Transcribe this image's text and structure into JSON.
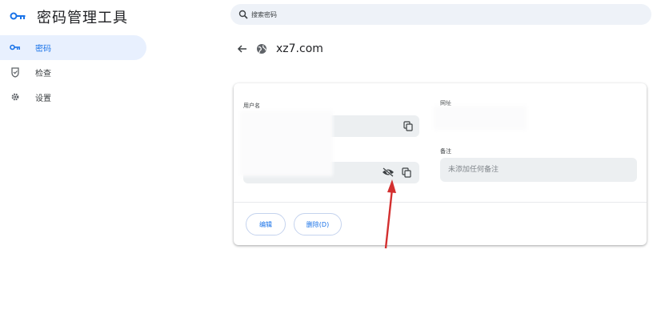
{
  "app": {
    "title": "密码管理工具"
  },
  "sidebar": {
    "items": [
      {
        "label": "密码",
        "icon": "key-icon",
        "active": true
      },
      {
        "label": "检查",
        "icon": "shield-check-icon",
        "active": false
      },
      {
        "label": "设置",
        "icon": "gear-icon",
        "active": false
      }
    ]
  },
  "search": {
    "placeholder": "搜索密码",
    "value": ""
  },
  "detail": {
    "site": "xz7.com",
    "username_label": "用户名",
    "password_label": "",
    "website_label": "网址",
    "notes_label": "备注",
    "notes_placeholder": "未添加任何备注",
    "edit_label": "编辑",
    "delete_label": "删除(D)"
  },
  "colors": {
    "accent": "#1a73e8",
    "active_nav_bg": "#e8f0fe",
    "field_bg": "#eceff1",
    "annotation": "#d32f2f"
  }
}
